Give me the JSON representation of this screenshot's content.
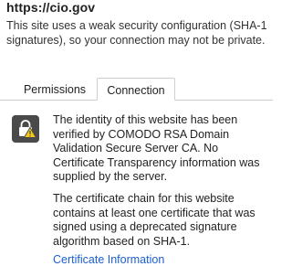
{
  "header": {
    "site": "https://cio.gov",
    "description": "This site uses a weak security configuration (SHA-1 signatures), so your connection may not be private."
  },
  "tabs": [
    {
      "label": "Permissions",
      "selected": false
    },
    {
      "label": "Connection",
      "selected": true
    }
  ],
  "connection": {
    "status_icon": "lock-warning-icon",
    "identity_text": "The identity of this website has been verified by COMODO RSA Domain Validation Secure Server CA. No Certificate Transparency information was supplied by the server.",
    "chain_text": "The certificate chain for this website contains at least one certificate that was signed using a deprecated signature algorithm based on SHA-1.",
    "certificate_link": "Certificate Information"
  },
  "colors": {
    "icon_background": "#4a4a4a",
    "warning_triangle": "#f3c81a",
    "link": "#1a5fd1",
    "tab_border": "#cfcfcf"
  }
}
